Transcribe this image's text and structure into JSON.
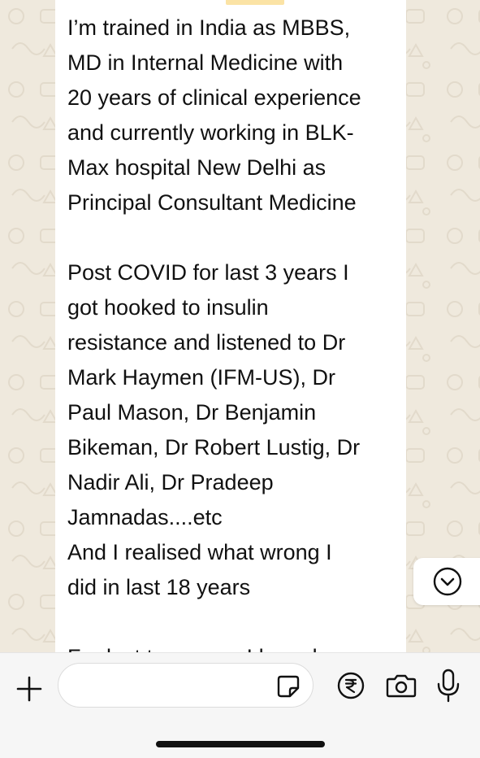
{
  "chat": {
    "message_lines": [
      "",
      "I’m trained in India as MBBS,",
      "MD in Internal Medicine with",
      "20 years of clinical experience",
      "and currently working in BLK-",
      "Max hospital New Delhi as",
      "Principal Consultant Medicine",
      "",
      "Post COVID for last 3 years I",
      "got hooked to insulin",
      "resistance and listened to Dr",
      "Mark Haymen (IFM-US), Dr",
      "Paul Mason, Dr Benjamin",
      "Bikeman, Dr Robert Lustig, Dr",
      "Nadir Ali, Dr Pradeep",
      "Jamnadas....etc",
      "And I realised what wrong I",
      "did in last 18 years",
      "",
      "For last two years I have been"
    ],
    "scroll_down_icon": "chevron-down-circle-icon"
  },
  "composer": {
    "input_value": "",
    "plus_icon": "plus-icon",
    "sticker_icon": "sticker-icon",
    "payment_icon": "rupee-icon",
    "camera_icon": "camera-icon",
    "mic_icon": "microphone-icon"
  },
  "colors": {
    "wallpaper": "#efe9dd",
    "bubble": "#ffffff",
    "highlight": "#fbe3a5",
    "text": "#111111"
  }
}
